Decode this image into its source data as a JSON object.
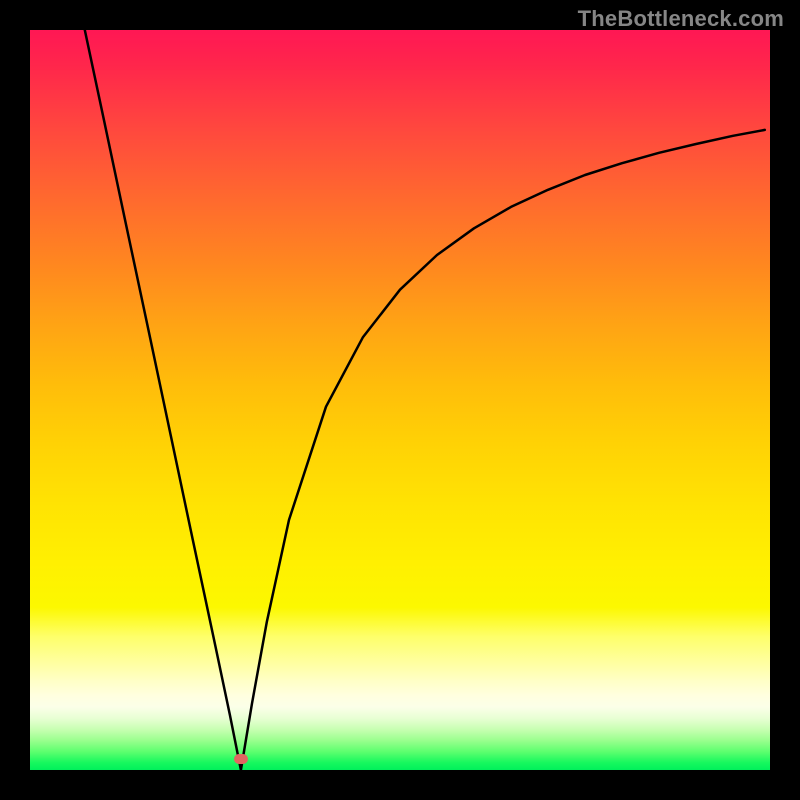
{
  "watermark": "TheBottleneck.com",
  "marker": {
    "x_frac": 0.285,
    "y_frac": 0.985
  },
  "chart_data": {
    "type": "line",
    "title": "",
    "xlabel": "",
    "ylabel": "",
    "xlim": [
      0,
      1
    ],
    "ylim": [
      0,
      1
    ],
    "series": [
      {
        "name": "curve",
        "x": [
          0.074,
          0.1,
          0.13,
          0.16,
          0.19,
          0.22,
          0.25,
          0.27,
          0.285,
          0.3,
          0.32,
          0.35,
          0.4,
          0.45,
          0.5,
          0.55,
          0.6,
          0.65,
          0.7,
          0.75,
          0.8,
          0.85,
          0.9,
          0.95,
          0.993
        ],
        "y": [
          1.0,
          0.878,
          0.736,
          0.595,
          0.453,
          0.311,
          0.17,
          0.075,
          0.0,
          0.09,
          0.2,
          0.338,
          0.491,
          0.585,
          0.649,
          0.696,
          0.732,
          0.761,
          0.784,
          0.804,
          0.82,
          0.834,
          0.846,
          0.857,
          0.865
        ]
      }
    ]
  },
  "colors": {
    "background": "#000000",
    "curve": "#000000",
    "marker": "#e06660",
    "watermark": "#868686"
  }
}
